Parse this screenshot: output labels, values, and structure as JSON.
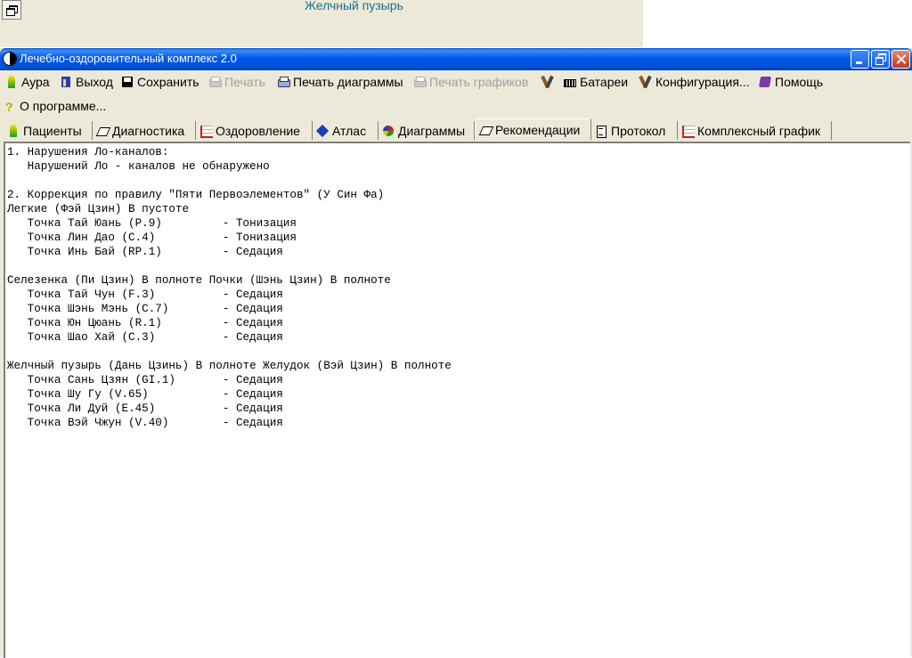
{
  "background_window": {
    "title": "Желчный пузырь"
  },
  "window": {
    "title": "Лечебно-оздоровительный комплекс 2.0"
  },
  "menu": [
    {
      "label": "Аура",
      "icon": "aura-icon",
      "enabled": true
    },
    {
      "label": "Выход",
      "icon": "exit-icon",
      "enabled": true
    },
    {
      "label": "Сохранить",
      "icon": "save-icon",
      "enabled": true
    },
    {
      "label": "Печать",
      "icon": "print-icon",
      "enabled": false
    },
    {
      "label": "Печать диаграммы",
      "icon": "print-icon",
      "enabled": true
    },
    {
      "label": "Печать графиков",
      "icon": "print-icon",
      "enabled": false
    },
    {
      "label": "",
      "icon": "tools-icon",
      "enabled": true
    },
    {
      "label": "Батареи",
      "icon": "battery-icon",
      "enabled": true
    },
    {
      "label": "Конфигурация...",
      "icon": "tools-icon",
      "enabled": true
    },
    {
      "label": "Помощь",
      "icon": "help-book-icon",
      "enabled": true
    },
    {
      "label": "О программе...",
      "icon": "question-icon",
      "enabled": true
    }
  ],
  "tabs": [
    {
      "label": "Пациенты",
      "icon": "patient-icon"
    },
    {
      "label": "Диагностика",
      "icon": "diagnostic-icon"
    },
    {
      "label": "Оздоровление",
      "icon": "chart-icon"
    },
    {
      "label": "Атлас",
      "icon": "atlas-icon"
    },
    {
      "label": "Диаграммы",
      "icon": "globe-icon"
    },
    {
      "label": "Рекомендации",
      "icon": "diagnostic-icon",
      "active": true
    },
    {
      "label": "Протокол",
      "icon": "protocol-icon"
    },
    {
      "label": "Комплексный график",
      "icon": "chart-icon"
    }
  ],
  "report_lines": [
    "1. Нарушения Ло-каналов:",
    "   Нарушений Ло - каналов не обнаружено",
    "",
    "2. Коррекция по правилу \"Пяти Первоэлементов\" (У Син Фа)",
    "Легкие (Фэй Цзин) В пустоте",
    "   Точка Тай Юань (P.9)         - Тонизация",
    "   Точка Лин Дао (C.4)          - Тонизация",
    "   Точка Инь Бай (RP.1)         - Седация",
    "",
    "Селезенка (Пи Цзин) В полноте Почки (Шэнь Цзин) В полноте",
    "   Точка Тай Чун (F.3)          - Седация",
    "   Точка Шэнь Мэнь (C.7)        - Седация",
    "   Точка Юн Цюань (R.1)         - Седация",
    "   Точка Шао Хай (C.3)          - Седация",
    "",
    "Желчный пузырь (Дань Цзинь) В полноте Желудок (Вэй Цзин) В полноте",
    "   Точка Сань Цзян (GI.1)       - Седация",
    "   Точка Шу Гу (V.65)           - Седация",
    "   Точка Ли Дуй (E.45)          - Седация",
    "   Точка Вэй Чжун (V.40)        - Седация"
  ]
}
